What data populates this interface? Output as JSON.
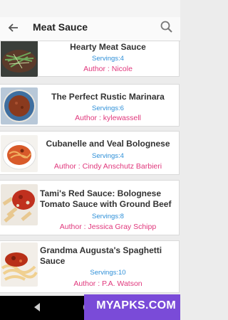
{
  "search": {
    "query": "Meat Sauce"
  },
  "recipes": [
    {
      "title": "Hearty Meat Sauce",
      "servings": "Servings:4",
      "author": "Author : Nicole",
      "thumb": "pasta-greens"
    },
    {
      "title": "The Perfect Rustic Marinara",
      "servings": "Servings:6",
      "author": "Author : kylewassell",
      "thumb": "sauce-bowl"
    },
    {
      "title": "Cubanelle and Veal Bolognese",
      "servings": "Servings:4",
      "author": "Author : Cindy Anschutz Barbieri",
      "thumb": "pasta-bowl"
    },
    {
      "title": "Tami's Red Sauce: Bolognese Tomato Sauce with Ground Beef",
      "servings": "Servings:8",
      "author": "Author : Jessica Gray Schipp",
      "thumb": "penne-sauce"
    },
    {
      "title": "Grandma Augusta's Spaghetti Sauce",
      "servings": "Servings:10",
      "author": "Author : P.A. Watson",
      "thumb": "spaghetti-plate"
    }
  ],
  "banner": {
    "text": "MYAPKS.COM"
  },
  "colors": {
    "servings": "#2d8fd8",
    "author": "#e0377c",
    "banner": "#7a4bd8"
  }
}
